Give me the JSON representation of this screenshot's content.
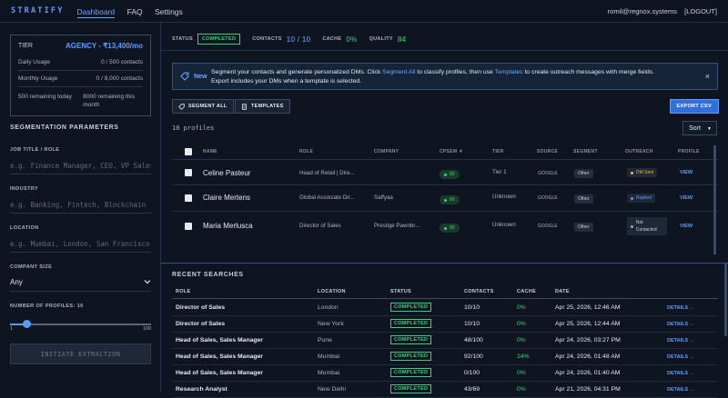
{
  "nav": {
    "logo": "STRATIFY",
    "links": [
      "Dashboard",
      "FAQ",
      "Settings"
    ],
    "email": "romil@regnox.systems",
    "logout": "[LOGOUT]"
  },
  "tier": {
    "label": "TIER",
    "plan": "AGENCY - ₹13,400/mo",
    "daily_label": "Daily Usage",
    "daily_value": "0 / 500 contacts",
    "monthly_label": "Monthly Usage",
    "monthly_value": "0 / 8,000 contacts",
    "remaining_today": "500 remaining today",
    "remaining_month": "8000 remaining this month"
  },
  "segmentation": {
    "title": "SEGMENTATION PARAMETERS",
    "job_label": "JOB TITLE / ROLE",
    "job_placeholder": "e.g. Finance Manager, CEO, VP Sales",
    "industry_label": "INDUSTRY",
    "industry_placeholder": "e.g. Banking, Fintech, Blockchain",
    "location_label": "LOCATION",
    "location_placeholder": "e.g. Mumbai, London, San Francisco",
    "size_label": "COMPANY SIZE",
    "size_value": "Any",
    "profiles_label": "NUMBER OF PROFILES: 10",
    "profiles_value": 10,
    "slider_min": "1",
    "slider_max": "100",
    "extract_button": "INITIATE EXTRACTION"
  },
  "stats": {
    "status_label": "STATUS",
    "status_value": "COMPLETED",
    "contacts_label": "CONTACTS",
    "contacts_value": "10 / 10",
    "cache_label": "CACHE",
    "cache_value": "0%",
    "quality_label": "QUALITY",
    "quality_value": "84"
  },
  "banner": {
    "tag": "New",
    "text_1": "Segment your contacts and generate personalized DMs. Click ",
    "link_1": "Segment All",
    "text_2": " to classify profiles, then use ",
    "link_2": "Templates",
    "text_3": " to create outreach messages with merge fields.",
    "text_4": "Export includes your DMs when a template is selected.",
    "close": "×"
  },
  "toolbar": {
    "segment_all": "SEGMENT ALL",
    "templates": "TEMPLATES",
    "export": "EXPORT CSV"
  },
  "profiles": {
    "count": "10 profiles",
    "sort": "Sort",
    "columns": [
      "NAME",
      "ROLE",
      "COMPANY",
      "CPSEM ▼",
      "TIER",
      "SOURCE",
      "SEGMENT",
      "OUTREACH",
      "PROFILE"
    ],
    "rows": [
      {
        "name": "Celine Pasteur",
        "role": "Head of Retail | Dire...",
        "company": "",
        "score": "80",
        "tier": "Tier 1",
        "source": "GOOGLE",
        "segment": "Other",
        "outreach": "DM Sent",
        "outreach_color": "#f2b632",
        "profile": "VIEW"
      },
      {
        "name": "Claire Mertens",
        "role": "Global Associate Dir...",
        "company": "Saffyaa",
        "score": "80",
        "tier": "Unknown",
        "source": "GOOGLE",
        "segment": "Other",
        "outreach": "Replied",
        "outreach_color": "#5b9dff",
        "profile": "VIEW"
      },
      {
        "name": "Maria Merlusca",
        "role": "Director of Sales",
        "company": "Prestige Pawnbr...",
        "score": "80",
        "tier": "Unknown",
        "source": "GOOGLE",
        "segment": "Other",
        "outreach": "Not Contacted",
        "outreach_color": "#9aa4b2",
        "profile": "VIEW"
      }
    ]
  },
  "recent": {
    "title": "RECENT SEARCHES",
    "columns": [
      "ROLE",
      "LOCATION",
      "STATUS",
      "CONTACTS",
      "CACHE",
      "DATE"
    ],
    "rows": [
      {
        "role": "Director of Sales",
        "location": "London",
        "status": "COMPLETED",
        "contacts": "10/10",
        "cache": "0%",
        "date": "Apr 25, 2026, 12:46 AM",
        "details": "DETAILS →"
      },
      {
        "role": "Director of Sales",
        "location": "New York",
        "status": "COMPLETED",
        "contacts": "10/10",
        "cache": "0%",
        "date": "Apr 25, 2026, 12:44 AM",
        "details": "DETAILS →"
      },
      {
        "role": "Head of Sales, Sales Manager",
        "location": "Pune",
        "status": "COMPLETED",
        "contacts": "48/100",
        "cache": "0%",
        "date": "Apr 24, 2026, 03:27 PM",
        "details": "DETAILS →"
      },
      {
        "role": "Head of Sales, Sales Manager",
        "location": "Mumbai",
        "status": "COMPLETED",
        "contacts": "92/100",
        "cache": "24%",
        "date": "Apr 24, 2026, 01:48 AM",
        "details": "DETAILS →"
      },
      {
        "role": "Head of Sales, Sales Manager",
        "location": "Mumbai",
        "status": "COMPLETED",
        "contacts": "0/100",
        "cache": "0%",
        "date": "Apr 24, 2026, 01:40 AM",
        "details": "DETAILS →"
      },
      {
        "role": "Research Analyst",
        "location": "New Delhi",
        "status": "COMPLETED",
        "contacts": "43/69",
        "cache": "0%",
        "date": "Apr 21, 2026, 04:31 PM",
        "details": "DETAILS →"
      }
    ]
  }
}
